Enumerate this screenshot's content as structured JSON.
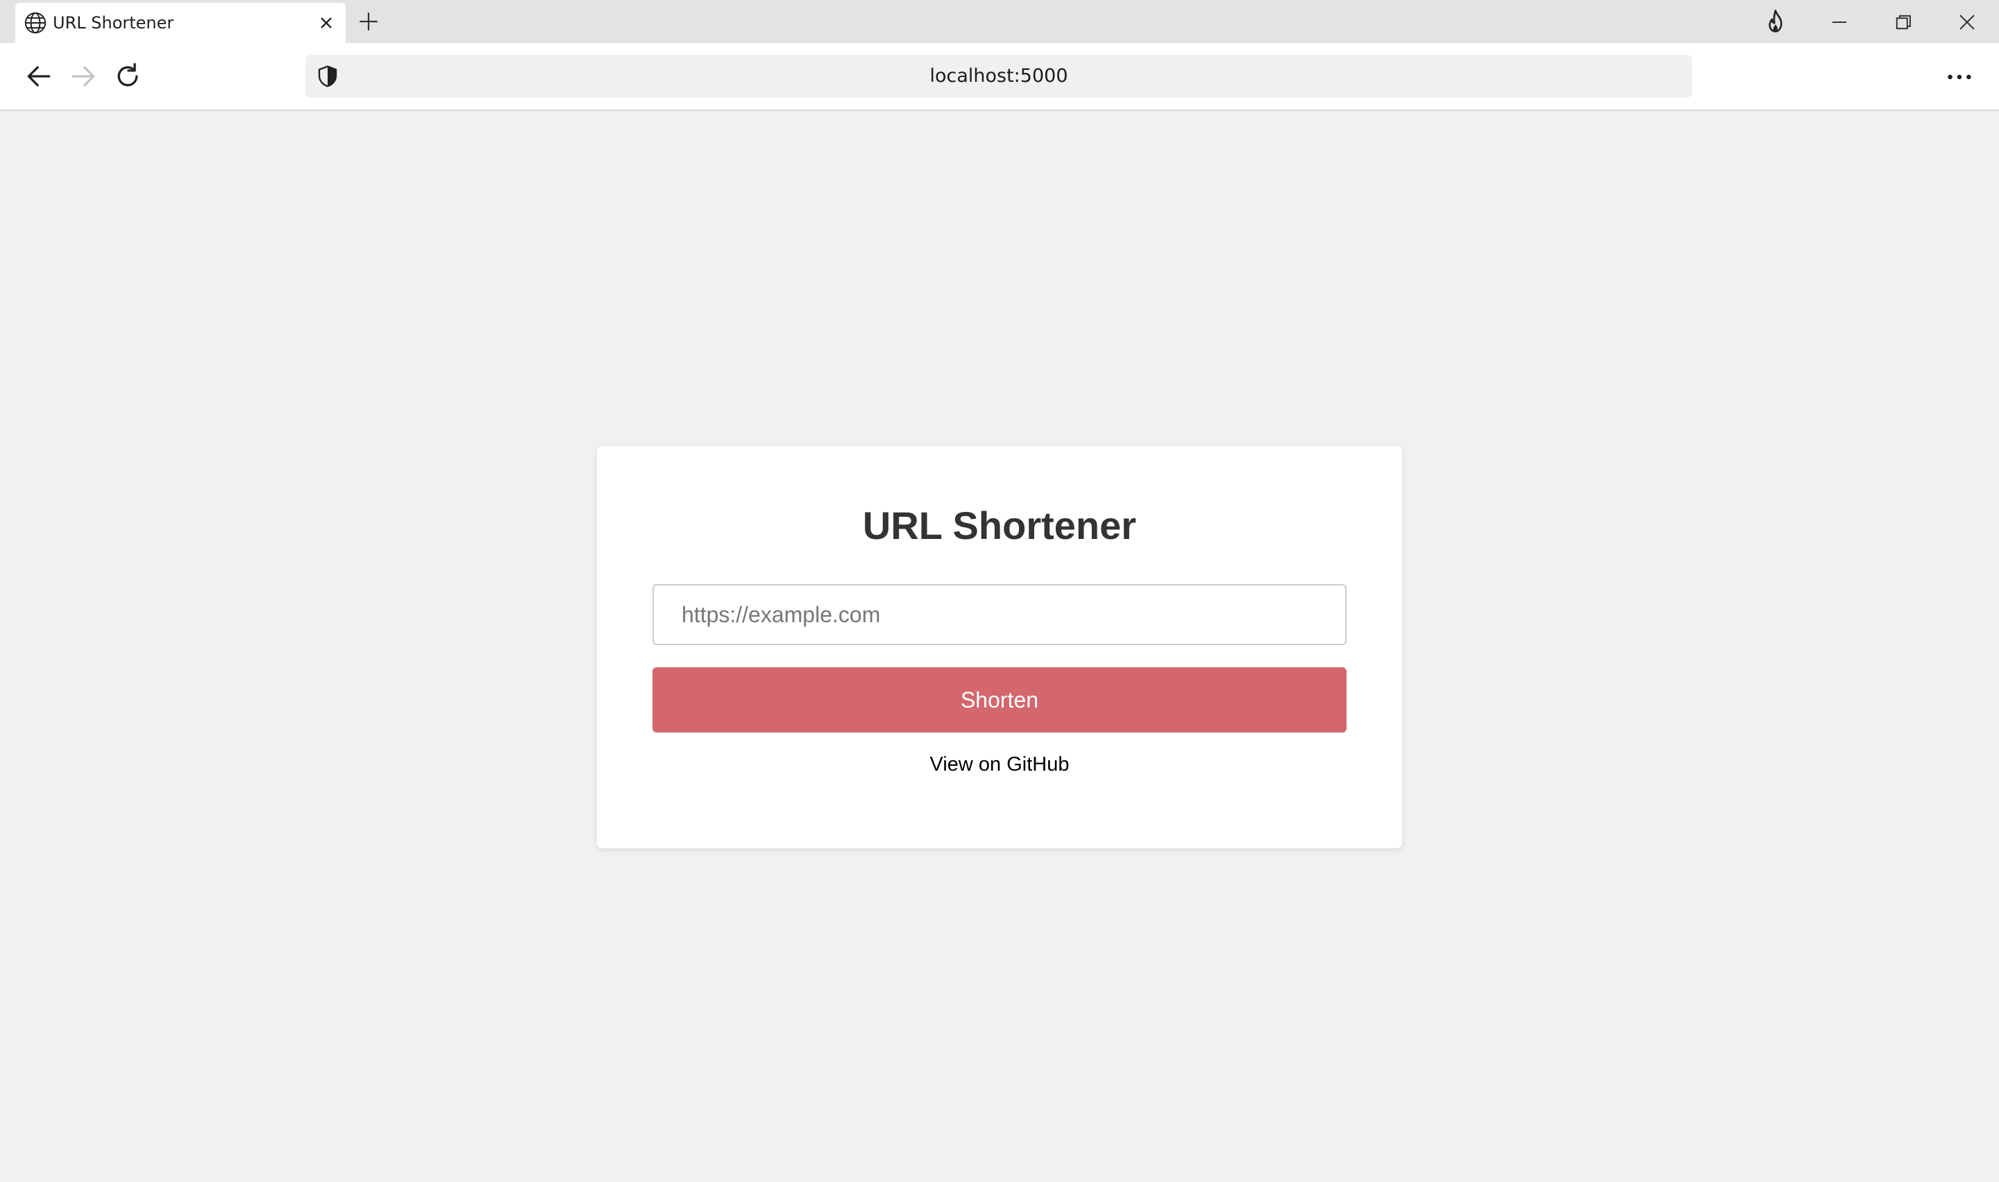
{
  "browser": {
    "tab": {
      "title": "URL Shortener",
      "icon": "globe-icon"
    },
    "new_tab_icon": "plus-icon",
    "window_controls": [
      "flame-icon",
      "minimize-icon",
      "restore-icon",
      "close-icon"
    ],
    "address_bar": {
      "url": "localhost:5000",
      "security_icon": "shield-icon"
    },
    "nav": [
      "back-arrow-icon",
      "forward-arrow-icon",
      "reload-icon"
    ],
    "menu_icon": "more-dots-icon"
  },
  "page": {
    "title": "URL Shortener",
    "input": {
      "placeholder": "https://example.com",
      "value": ""
    },
    "submit_label": "Shorten",
    "footer_link": "View on GitHub",
    "colors": {
      "background": "#f1f1f1",
      "card": "#ffffff",
      "button": "#d4676d",
      "button_text": "#ffffff",
      "title": "#333333"
    }
  }
}
